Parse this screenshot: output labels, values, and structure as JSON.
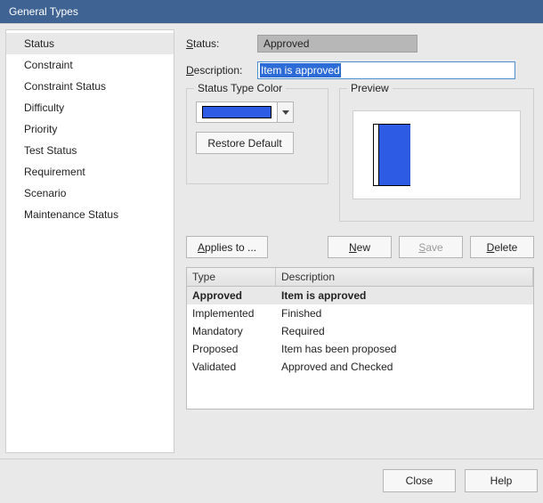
{
  "title": "General Types",
  "sidebar": {
    "items": [
      {
        "label": "Status",
        "selected": true
      },
      {
        "label": "Constraint",
        "selected": false
      },
      {
        "label": "Constraint Status",
        "selected": false
      },
      {
        "label": "Difficulty",
        "selected": false
      },
      {
        "label": "Priority",
        "selected": false
      },
      {
        "label": "Test Status",
        "selected": false
      },
      {
        "label": "Requirement",
        "selected": false
      },
      {
        "label": "Scenario",
        "selected": false
      },
      {
        "label": "Maintenance Status",
        "selected": false
      }
    ]
  },
  "form": {
    "status_label_prefix": "S",
    "status_label_rest": "tatus:",
    "status_value": "Approved",
    "desc_label_prefix": "D",
    "desc_label_rest": "escription:",
    "desc_value": "Item is approved"
  },
  "groups": {
    "color_legend": "Status Type Color",
    "preview_legend": "Preview",
    "restore_label": "Restore Default",
    "color_hex": "#2d5be3"
  },
  "buttons": {
    "applies_prefix": "A",
    "applies_rest": "pplies to ...",
    "new_prefix": "N",
    "new_rest": "ew",
    "save_prefix": "S",
    "save_rest": "ave",
    "delete_prefix": "D",
    "delete_rest": "elete",
    "close": "Close",
    "help": "Help"
  },
  "table": {
    "headers": {
      "type": "Type",
      "desc": "Description"
    },
    "rows": [
      {
        "type": "Approved",
        "desc": "Item is approved",
        "selected": true
      },
      {
        "type": "Implemented",
        "desc": "Finished",
        "selected": false
      },
      {
        "type": "Mandatory",
        "desc": "Required",
        "selected": false
      },
      {
        "type": "Proposed",
        "desc": "Item has been proposed",
        "selected": false
      },
      {
        "type": "Validated",
        "desc": "Approved and Checked",
        "selected": false
      }
    ]
  }
}
